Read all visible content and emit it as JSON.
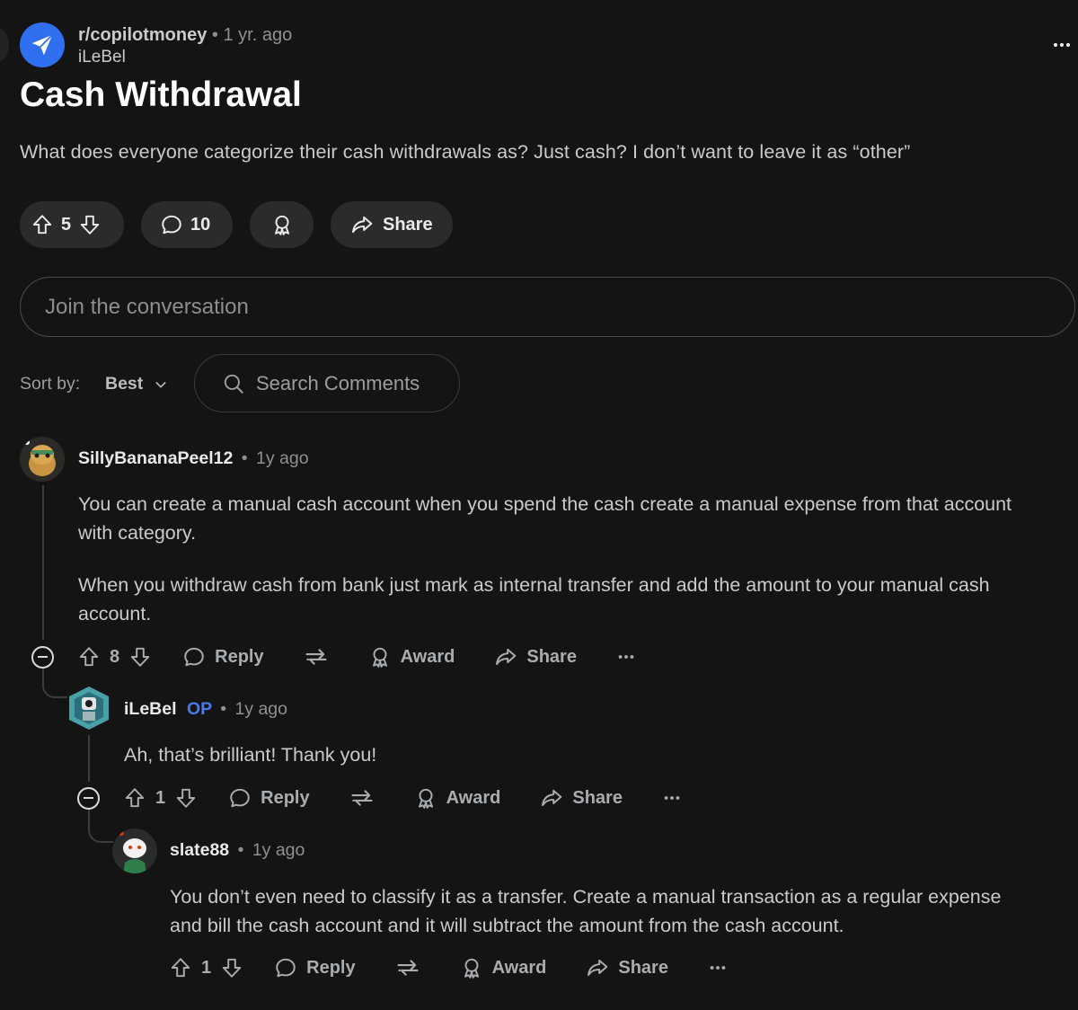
{
  "post": {
    "subreddit": "r/copilotmoney",
    "separator": "•",
    "age": "1 yr. ago",
    "author": "iLeBel",
    "title": "Cash Withdrawal",
    "body": "What does everyone categorize their cash withdrawals as? Just cash? I don’t want to leave it as “other”",
    "score": "5",
    "comment_count": "10",
    "share_label": "Share"
  },
  "composer": {
    "placeholder": "Join the conversation"
  },
  "sort": {
    "label": "Sort by:",
    "value": "Best"
  },
  "search": {
    "placeholder": "Search Comments"
  },
  "comments": [
    {
      "author": "SillyBananaPeel12",
      "separator": "•",
      "age": "1y ago",
      "paragraphs": [
        "You can create a manual cash account when you spend the cash create a manual expense from that account with category.",
        "When you withdraw cash from bank just mark as internal transfer and add the amount to your manual cash account."
      ],
      "score": "8",
      "reply_label": "Reply",
      "award_label": "Award",
      "share_label": "Share"
    },
    {
      "author": "iLeBel",
      "badge": "OP",
      "separator": "•",
      "age": "1y ago",
      "text": "Ah, that’s brilliant! Thank you!",
      "score": "1",
      "reply_label": "Reply",
      "award_label": "Award",
      "share_label": "Share"
    },
    {
      "author": "slate88",
      "separator": "•",
      "age": "1y ago",
      "text": "You don’t even need to classify it as a transfer. Create a manual transaction as a regular expense and bill the cash account and it will subtract the amount from the cash account.",
      "score": "1",
      "reply_label": "Reply",
      "award_label": "Award",
      "share_label": "Share"
    }
  ],
  "icons": {
    "subreddit": "paper-plane-icon",
    "upvote": "arrow-up-icon",
    "downvote": "arrow-down-icon",
    "comment": "speech-bubble-icon",
    "award": "award-ribbon-icon",
    "share": "share-arrow-icon",
    "crosspost": "crosspost-icon",
    "more": "ellipsis-icon",
    "search": "search-icon",
    "collapse": "collapse-icon"
  },
  "colors": {
    "background": "#141415",
    "accent": "#2f6ff0",
    "op_badge": "#4a79e8"
  }
}
